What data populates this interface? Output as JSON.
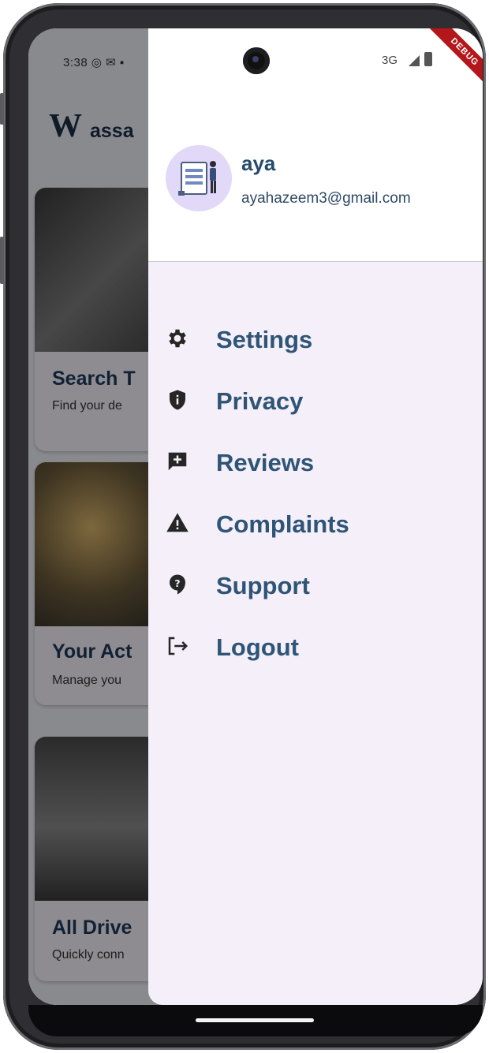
{
  "status_bar": {
    "time": "3:38",
    "network": "3G",
    "debug_banner": "DEBUG"
  },
  "background_app": {
    "logo_letter": "W",
    "logo_text": "assa",
    "cards": [
      {
        "title": "Search T",
        "subtitle": "Find your de"
      },
      {
        "title": "Your Act",
        "subtitle": "Manage you"
      },
      {
        "title": "All Drive",
        "subtitle": "Quickly conn"
      }
    ]
  },
  "drawer": {
    "user": {
      "name": "aya",
      "email": "ayahazeem3@gmail.com"
    },
    "menu": [
      {
        "label": "Settings",
        "icon": "gear-icon"
      },
      {
        "label": "Privacy",
        "icon": "shield-icon"
      },
      {
        "label": "Reviews",
        "icon": "review-icon"
      },
      {
        "label": "Complaints",
        "icon": "warning-icon"
      },
      {
        "label": "Support",
        "icon": "help-icon"
      },
      {
        "label": "Logout",
        "icon": "logout-icon"
      }
    ]
  },
  "colors": {
    "accent": "#2f5576",
    "drawer_bg": "#f4eff8",
    "header_bg": "#ffffff",
    "debug": "#b3171b"
  }
}
